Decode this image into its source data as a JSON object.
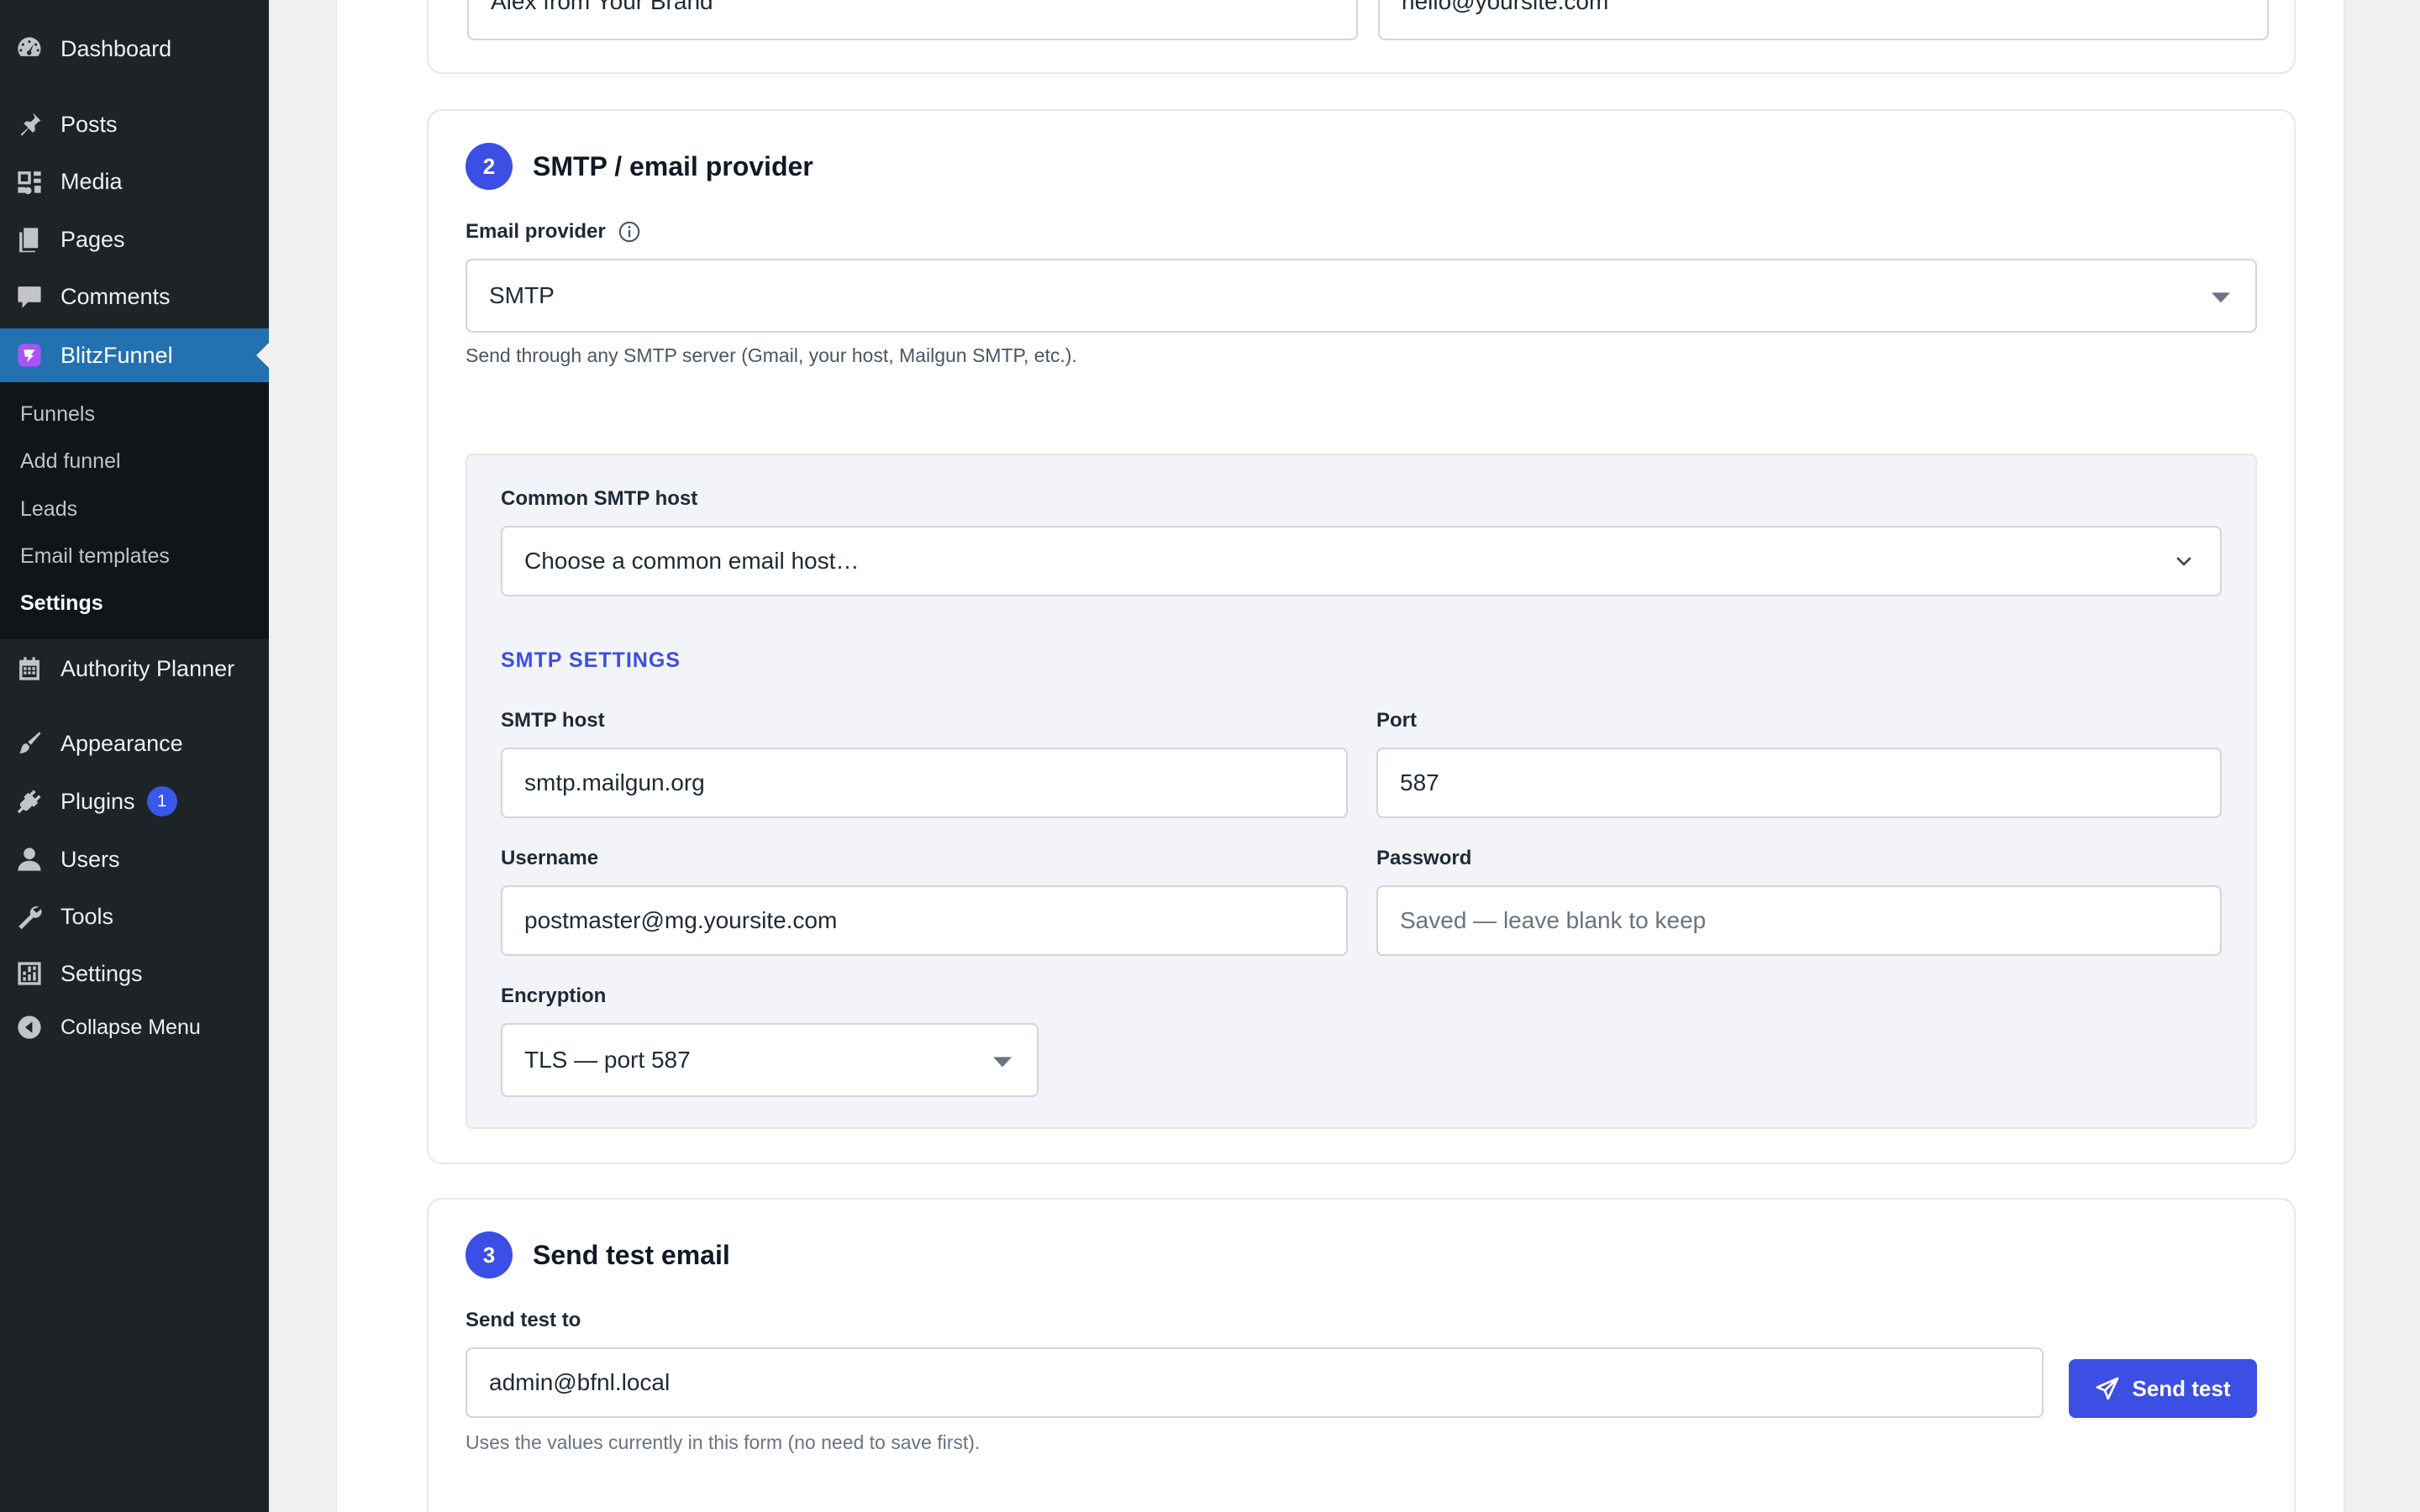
{
  "sidebar": {
    "items": [
      {
        "label": "Dashboard",
        "icon": "dashboard-icon"
      },
      {
        "label": "Posts",
        "icon": "pin-icon"
      },
      {
        "label": "Media",
        "icon": "media-icon"
      },
      {
        "label": "Pages",
        "icon": "pages-icon"
      },
      {
        "label": "Comments",
        "icon": "comments-icon"
      },
      {
        "label": "BlitzFunnel",
        "icon": "blitzfunnel-icon"
      },
      {
        "label": "Authority Planner",
        "icon": "calendar-icon"
      },
      {
        "label": "Appearance",
        "icon": "brush-icon"
      },
      {
        "label": "Plugins",
        "icon": "plugin-icon",
        "badge": "1"
      },
      {
        "label": "Users",
        "icon": "user-icon"
      },
      {
        "label": "Tools",
        "icon": "wrench-icon"
      },
      {
        "label": "Settings",
        "icon": "settings-icon"
      }
    ],
    "submenu": [
      "Funnels",
      "Add funnel",
      "Leads",
      "Email templates",
      "Settings"
    ],
    "collapse_label": "Collapse Menu",
    "accent_color": "#2271b1"
  },
  "sender": {
    "from_name_value": "Alex from Your Brand",
    "from_email_value": "hello@yoursite.com"
  },
  "smtp_card": {
    "step": "2",
    "title": "SMTP / email provider",
    "provider_label": "Email provider",
    "provider_value": "SMTP",
    "provider_hint": "Send through any SMTP server (Gmail, your host, Mailgun SMTP, etc.).",
    "common_host_label": "Common SMTP host",
    "common_host_value": "Choose a common email host…",
    "settings_heading": "SMTP SETTINGS",
    "host_label": "SMTP host",
    "host_value": "smtp.mailgun.org",
    "port_label": "Port",
    "port_value": "587",
    "username_label": "Username",
    "username_value": "postmaster@mg.yoursite.com",
    "password_label": "Password",
    "password_placeholder": "Saved — leave blank to keep",
    "encryption_label": "Encryption",
    "encryption_value": "TLS — port 587"
  },
  "test_card": {
    "step": "3",
    "title": "Send test email",
    "to_label": "Send test to",
    "to_value": "admin@bfnl.local",
    "button_label": "Send test",
    "hint": "Uses the values currently in this form (no need to save first)."
  },
  "colors": {
    "primary": "#3b4fe4",
    "sidebar_bg": "#1d2327"
  }
}
